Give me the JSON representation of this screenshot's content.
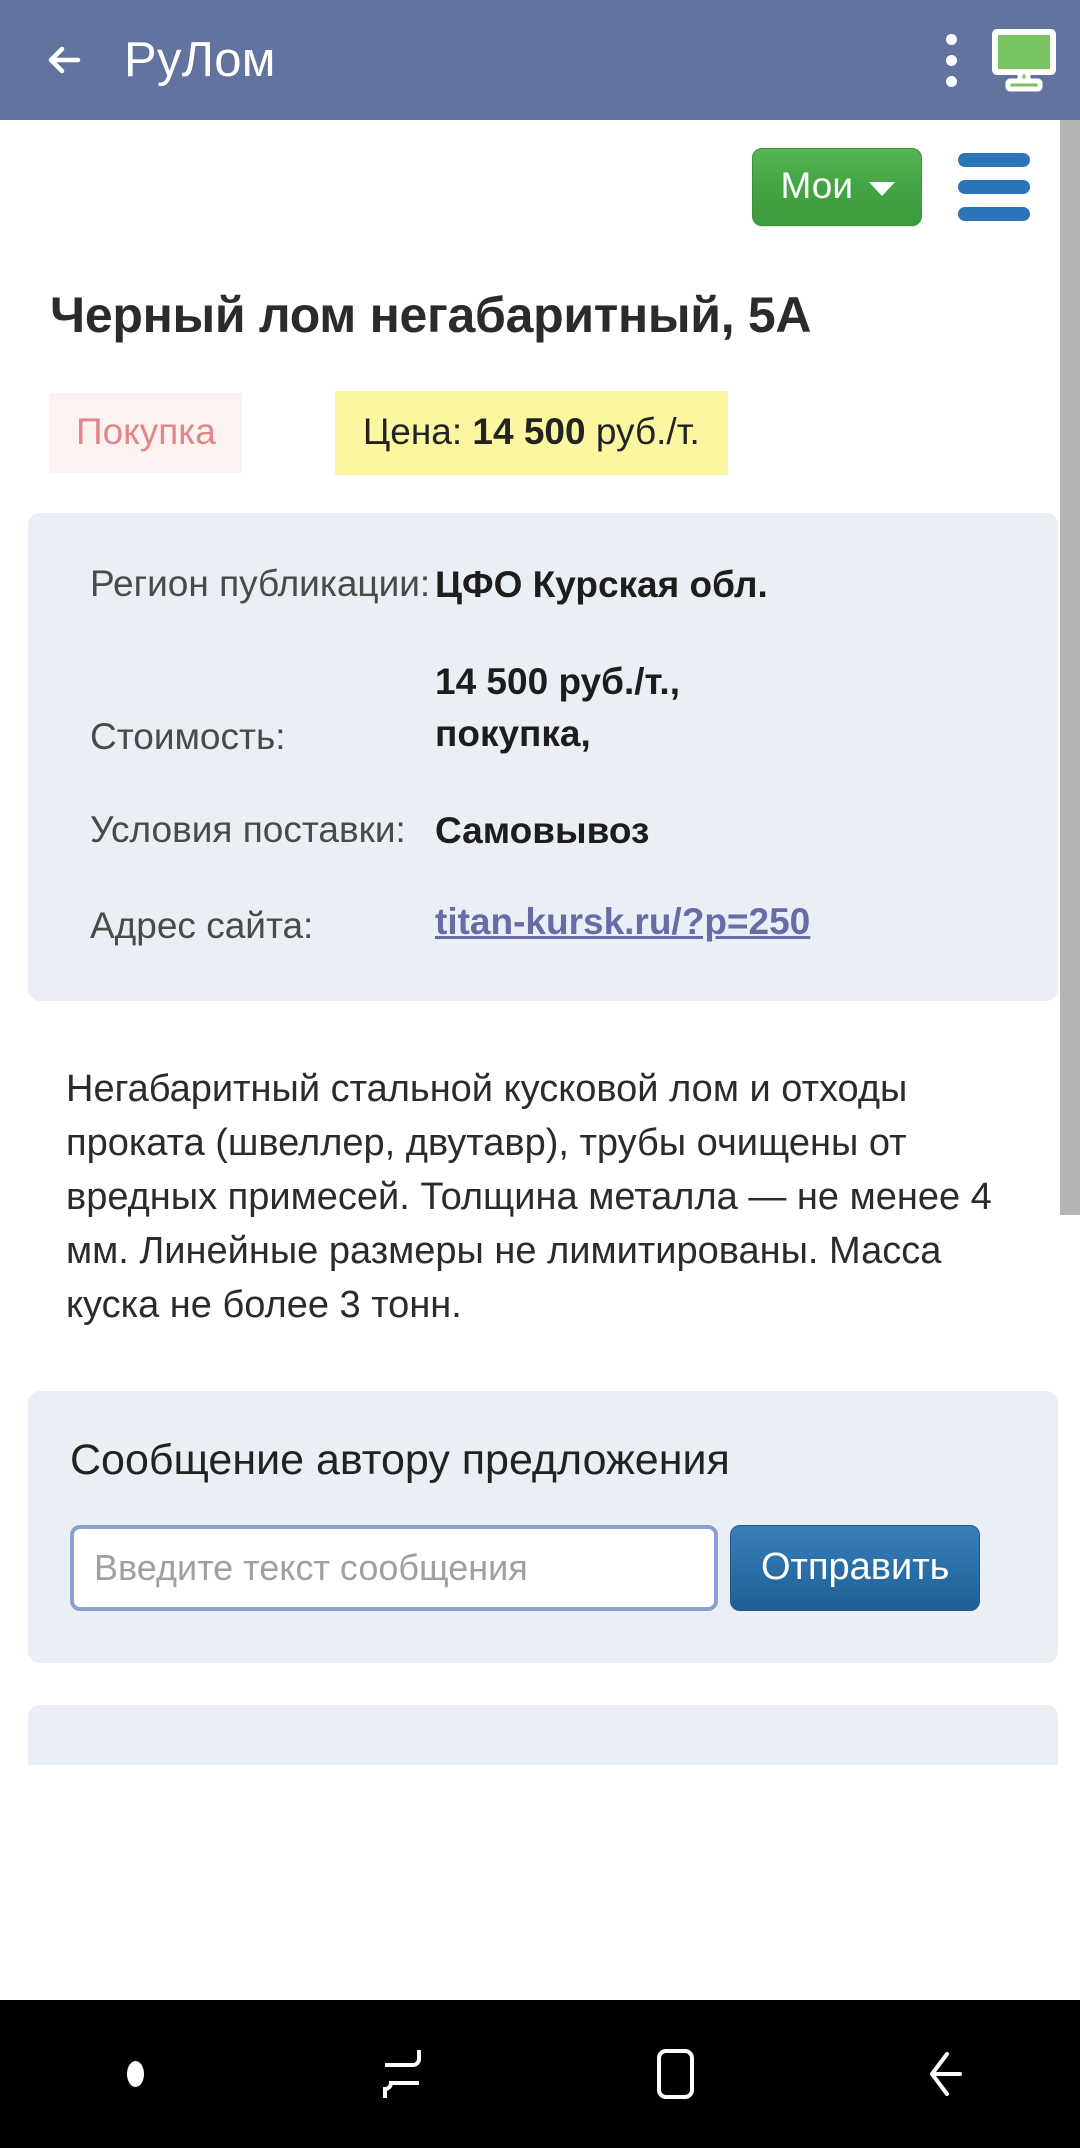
{
  "appbar": {
    "title": "РуЛом",
    "back_icon": "back-arrow-icon",
    "overflow_icon": "kebab-menu-icon",
    "cast_icon": "cast-monitor-icon",
    "bg_color": "#63739f",
    "cast_color": "#78c262"
  },
  "toolbar": {
    "my_label": "Мои",
    "my_caret": "chevron-down-icon",
    "my_color": "#44a544",
    "menu_icon": "hamburger-menu-icon",
    "menu_color": "#2b74b8"
  },
  "listing": {
    "title": "Черный лом негабаритный, 5А",
    "badges": {
      "deal_type": "Покупка",
      "deal_type_color": "#e08787",
      "deal_type_bg": "#fdf2f2",
      "price_prefix": "Цена: ",
      "price_value": "14 500",
      "price_suffix": " руб./т.",
      "price_bg": "#fbf7a0"
    },
    "details": [
      {
        "label": "Регион публикации:",
        "value": "ЦФО Курская обл.",
        "type": "text"
      },
      {
        "label": "Стоимость:",
        "value": "14 500 руб./т.,\nпокупка,",
        "value_line1": "14 500 руб./т.,",
        "value_line2": "покупка,",
        "type": "text"
      },
      {
        "label": "Условия поставки:",
        "value": "Самовывоз",
        "type": "text"
      },
      {
        "label": "Адрес сайта:",
        "value": "titan-kursk.ru/?p=250",
        "type": "link",
        "link_color": "#6a6aa8"
      }
    ],
    "description": "Негабаритный стальной кусковой лом и отходы проката (швеллер, двутавр), трубы очищены от вредных примесей. Толщина металла — не менее 4 мм. Линейные размеры не лимитированы. Масса куска не более 3 тонн."
  },
  "message_form": {
    "heading": "Сообщение автору предложения",
    "input_value": "",
    "input_placeholder": "Введите текст сообщения",
    "send_label": "Отправить",
    "send_color": "#2a6fa8"
  },
  "navbar": {
    "dot_icon": "indicator-dot-icon",
    "recents_icon": "recent-apps-icon",
    "home_icon": "home-square-icon",
    "back_icon": "back-chevron-icon"
  }
}
